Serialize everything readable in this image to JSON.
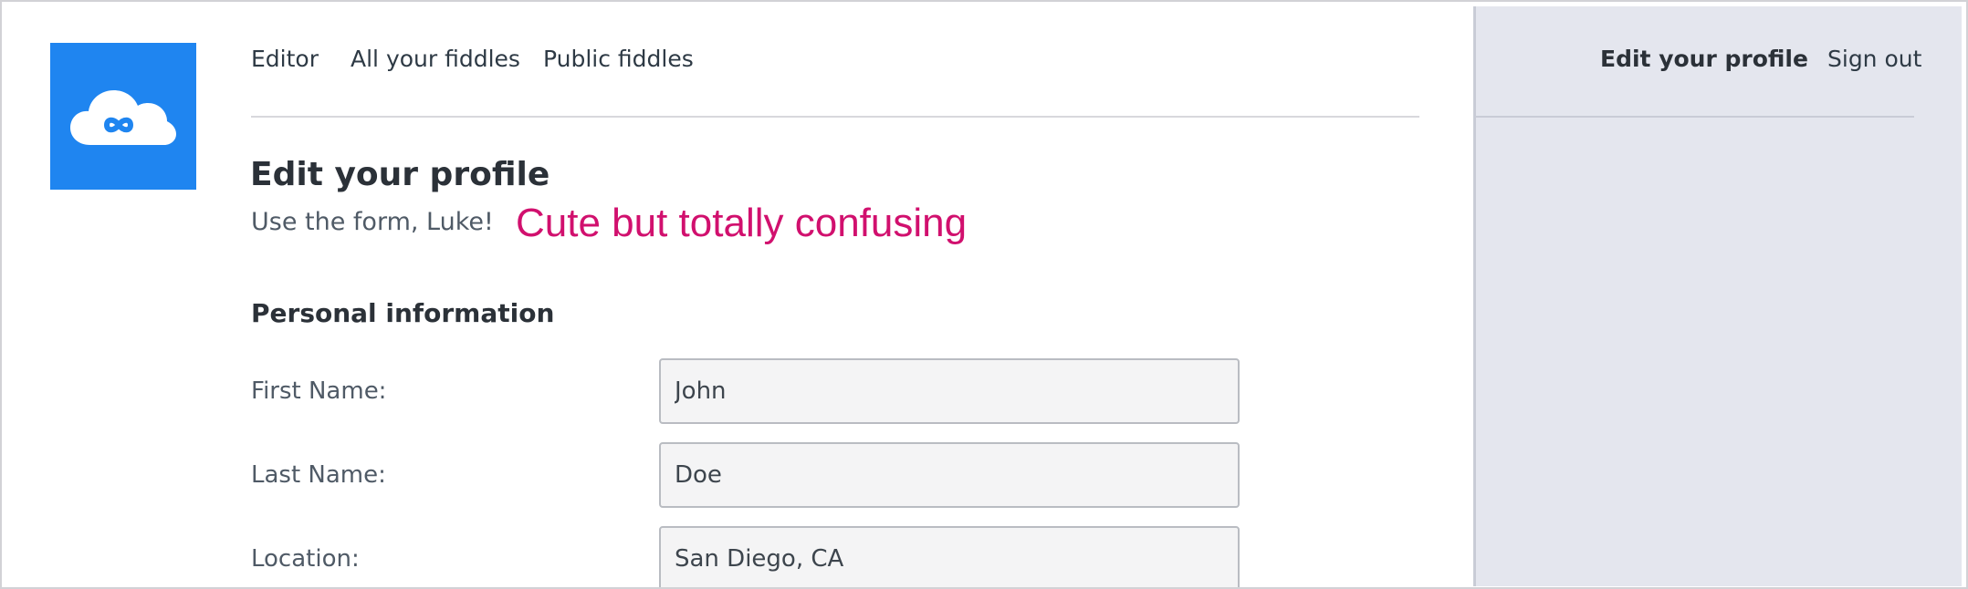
{
  "nav": {
    "editor": "Editor",
    "all_fiddles": "All your fiddles",
    "public_fiddles": "Public fiddles",
    "edit_profile": "Edit your profile",
    "sign_out": "Sign out"
  },
  "logo": {
    "icon": "cloud-infinity-icon",
    "color": "#1f85f0"
  },
  "main": {
    "title": "Edit your profile",
    "subtitle": "Use the form, Luke!",
    "annotation": "Cute but totally confusing",
    "section_heading": "Personal information"
  },
  "form": {
    "fields": [
      {
        "label": "First Name:",
        "value": "John"
      },
      {
        "label": "Last Name:",
        "value": "Doe"
      },
      {
        "label": "Location:",
        "value": "San Diego, CA"
      }
    ]
  },
  "colors": {
    "annotation": "#d1106e",
    "sidebar_bg": "#e4e6ee"
  }
}
